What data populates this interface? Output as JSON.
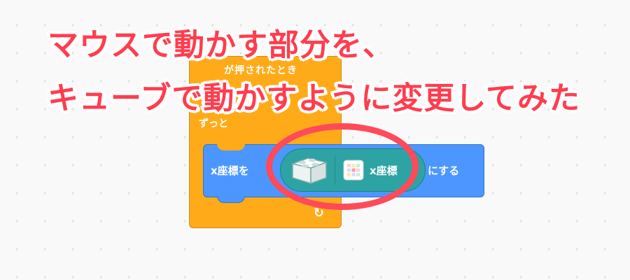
{
  "caption": {
    "line1": "マウスで動かす部分を、",
    "line2": "キューブで動かすように変更してみた"
  },
  "control_block": {
    "hat_text": "が押されたとき",
    "forever_label": "ずっと",
    "loop_icon": "loop-arrow-icon"
  },
  "motion_block": {
    "label": "x座標を",
    "suffix": "にする"
  },
  "reporter_block": {
    "extension_icon": "cube-icon",
    "sensor_icon": "color-palette-icon",
    "label": "x座標"
  },
  "colors": {
    "highlight": "#ff4a5a",
    "caption_text": "#ff3d4e",
    "control": "#ffab19",
    "motion": "#4c97ff",
    "extension": "#2ea3a3"
  }
}
